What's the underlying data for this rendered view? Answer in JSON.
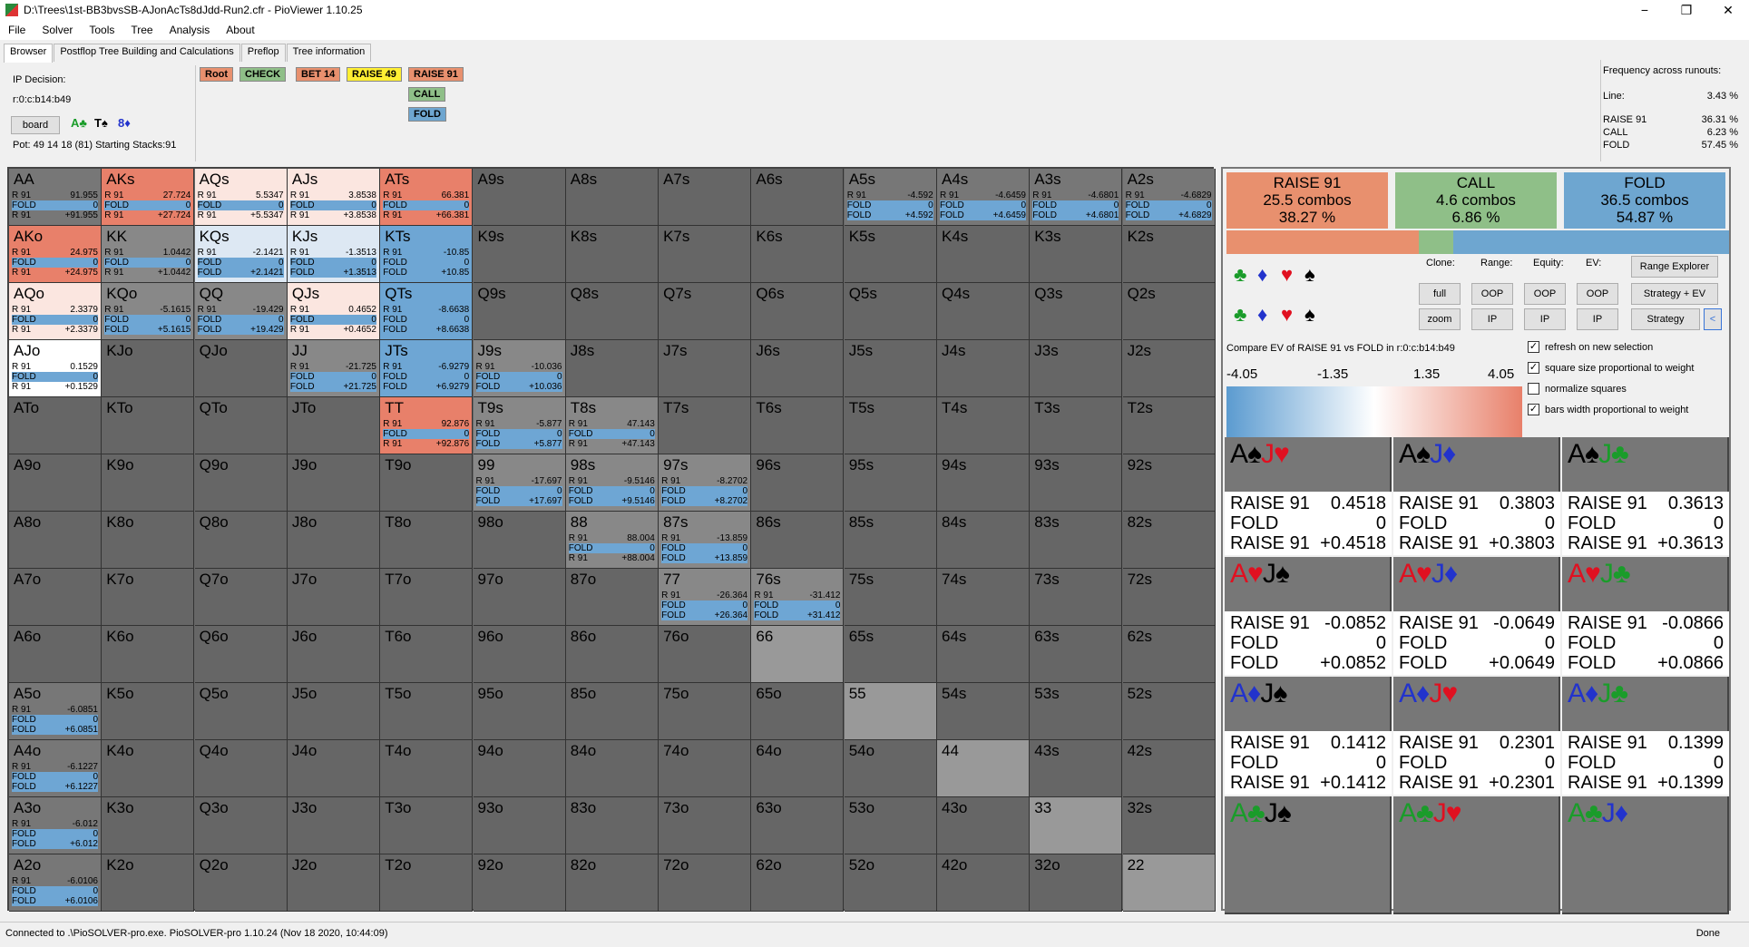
{
  "window": {
    "title": "D:\\Trees\\1st-BB3bvsSB-AJonAcTs8dJdd-Run2.cfr - PioViewer 1.10.25",
    "minimize": "−",
    "maximize": "❐",
    "close": "✕"
  },
  "menu": [
    "File",
    "Solver",
    "Tools",
    "Tree",
    "Analysis",
    "About"
  ],
  "tabs": [
    "Browser",
    "Postflop Tree Building and Calculations",
    "Preflop",
    "Tree information"
  ],
  "left_info": {
    "decision": "IP Decision:",
    "path": "r:0:c:b14:b49",
    "board_button": "board",
    "board_cards": [
      "A♣",
      "T♠",
      "8♦"
    ],
    "pot": "Pot: 49 14 18 (81) Starting Stacks:91"
  },
  "nodes": [
    "Root",
    "CHECK",
    "BET 14",
    "RAISE 49",
    "RAISE 91",
    "CALL",
    "FOLD"
  ],
  "right_info": {
    "header": "Frequency across runouts:",
    "line_label": "Line:",
    "line_value": "3.43 %",
    "rows": [
      [
        "RAISE 91",
        "36.31 %"
      ],
      [
        "CALL",
        "6.23 %"
      ],
      [
        "FOLD",
        "57.45 %"
      ]
    ]
  },
  "grid": [
    [
      "AA",
      "AKs",
      "AQs",
      "AJs",
      "ATs",
      "A9s",
      "A8s",
      "A7s",
      "A6s",
      "A5s",
      "A4s",
      "A3s",
      "A2s"
    ],
    [
      "AKo",
      "KK",
      "KQs",
      "KJs",
      "KTs",
      "K9s",
      "K8s",
      "K7s",
      "K6s",
      "K5s",
      "K4s",
      "K3s",
      "K2s"
    ],
    [
      "AQo",
      "KQo",
      "QQ",
      "QJs",
      "QTs",
      "Q9s",
      "Q8s",
      "Q7s",
      "Q6s",
      "Q5s",
      "Q4s",
      "Q3s",
      "Q2s"
    ],
    [
      "AJo",
      "KJo",
      "QJo",
      "JJ",
      "JTs",
      "J9s",
      "J8s",
      "J7s",
      "J6s",
      "J5s",
      "J4s",
      "J3s",
      "J2s"
    ],
    [
      "ATo",
      "KTo",
      "QTo",
      "JTo",
      "TT",
      "T9s",
      "T8s",
      "T7s",
      "T6s",
      "T5s",
      "T4s",
      "T3s",
      "T2s"
    ],
    [
      "A9o",
      "K9o",
      "Q9o",
      "J9o",
      "T9o",
      "99",
      "98s",
      "97s",
      "96s",
      "95s",
      "94s",
      "93s",
      "92s"
    ],
    [
      "A8o",
      "K8o",
      "Q8o",
      "J8o",
      "T8o",
      "98o",
      "88",
      "87s",
      "86s",
      "85s",
      "84s",
      "83s",
      "82s"
    ],
    [
      "A7o",
      "K7o",
      "Q7o",
      "J7o",
      "T7o",
      "97o",
      "87o",
      "77",
      "76s",
      "75s",
      "74s",
      "73s",
      "72s"
    ],
    [
      "A6o",
      "K6o",
      "Q6o",
      "J6o",
      "T6o",
      "96o",
      "86o",
      "76o",
      "66",
      "65s",
      "64s",
      "63s",
      "62s"
    ],
    [
      "A5o",
      "K5o",
      "Q5o",
      "J5o",
      "T5o",
      "95o",
      "85o",
      "75o",
      "65o",
      "55",
      "54s",
      "53s",
      "52s"
    ],
    [
      "A4o",
      "K4o",
      "Q4o",
      "J4o",
      "T4o",
      "94o",
      "84o",
      "74o",
      "64o",
      "54o",
      "44",
      "43s",
      "42s"
    ],
    [
      "A3o",
      "K3o",
      "Q3o",
      "J3o",
      "T3o",
      "93o",
      "83o",
      "73o",
      "63o",
      "53o",
      "43o",
      "33",
      "32s"
    ],
    [
      "A2o",
      "K2o",
      "Q2o",
      "J2o",
      "T2o",
      "92o",
      "82o",
      "72o",
      "62o",
      "52o",
      "42o",
      "32o",
      "22"
    ]
  ],
  "cell_data": {
    "AA": {
      "v": [
        "R 91",
        "91.955",
        "FOLD",
        "0",
        "R 91",
        "+91.955"
      ],
      "c": "#777"
    },
    "AKs": {
      "v": [
        "R 91",
        "27.724",
        "FOLD",
        "0",
        "R 91",
        "+27.724"
      ],
      "c": "#e8806a"
    },
    "AQs": {
      "v": [
        "R 91",
        "5.5347",
        "FOLD",
        "0",
        "R 91",
        "+5.5347"
      ],
      "c": "#fbe6e0"
    },
    "AJs": {
      "v": [
        "R 91",
        "3.8538",
        "FOLD",
        "0",
        "R 91",
        "+3.8538"
      ],
      "c": "#fbe6e0"
    },
    "ATs": {
      "v": [
        "R 91",
        "66.381",
        "FOLD",
        "0",
        "R 91",
        "+66.381"
      ],
      "c": "#e8806a"
    },
    "A5s": {
      "v": [
        "R 91",
        "-4.592",
        "FOLD",
        "0",
        "FOLD",
        "+4.592"
      ],
      "c": "#777"
    },
    "A4s": {
      "v": [
        "R 91",
        "-4.6459",
        "FOLD",
        "0",
        "FOLD",
        "+4.6459"
      ],
      "c": "#777"
    },
    "A3s": {
      "v": [
        "R 91",
        "-4.6801",
        "FOLD",
        "0",
        "FOLD",
        "+4.6801"
      ],
      "c": "#777"
    },
    "A2s": {
      "v": [
        "R 91",
        "-4.6829",
        "FOLD",
        "0",
        "FOLD",
        "+4.6829"
      ],
      "c": "#777"
    },
    "AKo": {
      "v": [
        "R 91",
        "24.975",
        "FOLD",
        "0",
        "R 91",
        "+24.975"
      ],
      "c": "#e8806a"
    },
    "KK": {
      "v": [
        "R 91",
        "1.0442",
        "FOLD",
        "0",
        "R 91",
        "+1.0442"
      ],
      "c": "#888"
    },
    "KQs": {
      "v": [
        "R 91",
        "-2.1421",
        "FOLD",
        "0",
        "FOLD",
        "+2.1421"
      ],
      "c": "#dde8f3"
    },
    "KJs": {
      "v": [
        "R 91",
        "-1.3513",
        "FOLD",
        "0",
        "FOLD",
        "+1.3513"
      ],
      "c": "#dde8f3"
    },
    "KTs": {
      "v": [
        "R 91",
        "-10.85",
        "FOLD",
        "0",
        "FOLD",
        "+10.85"
      ],
      "c": "#6ea6d4"
    },
    "AQo": {
      "v": [
        "R 91",
        "2.3379",
        "FOLD",
        "0",
        "R 91",
        "+2.3379"
      ],
      "c": "#fbe6e0"
    },
    "KQo": {
      "v": [
        "R 91",
        "-5.1615",
        "FOLD",
        "0",
        "FOLD",
        "+5.1615"
      ],
      "c": "#888"
    },
    "QQ": {
      "v": [
        "R 91",
        "-19.429",
        "FOLD",
        "0",
        "FOLD",
        "+19.429"
      ],
      "c": "#888"
    },
    "QJs": {
      "v": [
        "R 91",
        "0.4652",
        "FOLD",
        "0",
        "R 91",
        "+0.4652"
      ],
      "c": "#fbe6e0"
    },
    "QTs": {
      "v": [
        "R 91",
        "-8.6638",
        "FOLD",
        "0",
        "FOLD",
        "+8.6638"
      ],
      "c": "#6ea6d4"
    },
    "AJo": {
      "v": [
        "R 91",
        "0.1529",
        "FOLD",
        "0",
        "R 91",
        "+0.1529"
      ],
      "c": "#fff"
    },
    "JJ": {
      "v": [
        "R 91",
        "-21.725",
        "FOLD",
        "0",
        "FOLD",
        "+21.725"
      ],
      "c": "#888"
    },
    "JTs": {
      "v": [
        "R 91",
        "-6.9279",
        "FOLD",
        "0",
        "FOLD",
        "+6.9279"
      ],
      "c": "#6ea6d4"
    },
    "J9s": {
      "v": [
        "R 91",
        "-10.036",
        "FOLD",
        "0",
        "FOLD",
        "+10.036"
      ],
      "c": "#888"
    },
    "TT": {
      "v": [
        "R 91",
        "92.876",
        "FOLD",
        "0",
        "R 91",
        "+92.876"
      ],
      "c": "#e8806a"
    },
    "T9s": {
      "v": [
        "R 91",
        "-5.877",
        "FOLD",
        "0",
        "FOLD",
        "+5.877"
      ],
      "c": "#888"
    },
    "T8s": {
      "v": [
        "R 91",
        "47.143",
        "FOLD",
        "0",
        "R 91",
        "+47.143"
      ],
      "c": "#888"
    },
    "99": {
      "v": [
        "R 91",
        "-17.697",
        "FOLD",
        "0",
        "FOLD",
        "+17.697"
      ],
      "c": "#888"
    },
    "98s": {
      "v": [
        "R 91",
        "-9.5146",
        "FOLD",
        "0",
        "FOLD",
        "+9.5146"
      ],
      "c": "#888"
    },
    "97s": {
      "v": [
        "R 91",
        "-8.2702",
        "FOLD",
        "0",
        "FOLD",
        "+8.2702"
      ],
      "c": "#888"
    },
    "88": {
      "v": [
        "R 91",
        "88.004",
        "FOLD",
        "0",
        "R 91",
        "+88.004"
      ],
      "c": "#888"
    },
    "87s": {
      "v": [
        "R 91",
        "-13.859",
        "FOLD",
        "0",
        "FOLD",
        "+13.859"
      ],
      "c": "#888"
    },
    "77": {
      "v": [
        "R 91",
        "-26.364",
        "FOLD",
        "0",
        "FOLD",
        "+26.364"
      ],
      "c": "#888"
    },
    "76s": {
      "v": [
        "R 91",
        "-31.412",
        "FOLD",
        "0",
        "FOLD",
        "+31.412"
      ],
      "c": "#888"
    },
    "A5o": {
      "v": [
        "R 91",
        "-6.0851",
        "FOLD",
        "0",
        "FOLD",
        "+6.0851"
      ],
      "c": "#777"
    },
    "A4o": {
      "v": [
        "R 91",
        "-6.1227",
        "FOLD",
        "0",
        "FOLD",
        "+6.1227"
      ],
      "c": "#777"
    },
    "A3o": {
      "v": [
        "R 91",
        "-6.012",
        "FOLD",
        "0",
        "FOLD",
        "+6.012"
      ],
      "c": "#777"
    },
    "A2o": {
      "v": [
        "R 91",
        "-6.0106",
        "FOLD",
        "0",
        "FOLD",
        "+6.0106"
      ],
      "c": "#777"
    },
    "66": {
      "v": null,
      "c": "#999"
    },
    "55": {
      "v": null,
      "c": "#999"
    },
    "44": {
      "v": null,
      "c": "#999"
    },
    "33": {
      "v": null,
      "c": "#999"
    },
    "22": {
      "v": null,
      "c": "#999"
    }
  },
  "actions": [
    {
      "label": "RAISE 91",
      "combos": "25.5 combos",
      "pct": "38.27 %",
      "color": "#e8906e"
    },
    {
      "label": "CALL",
      "combos": "4.6 combos",
      "pct": "6.86 %",
      "color": "#8fbf88"
    },
    {
      "label": "FOLD",
      "combos": "36.5 combos",
      "pct": "54.87 %",
      "color": "#6ea6d0"
    }
  ],
  "freq_bar": {
    "raise": 0.3827,
    "call": 0.0686,
    "fold": 0.5487
  },
  "controls": {
    "clone": "Clone:",
    "range": "Range:",
    "equity": "Equity:",
    "ev": "EV:",
    "range_explorer": "Range Explorer",
    "full": "full",
    "zoom": "zoom",
    "oop": "OOP",
    "ip": "IP",
    "strategy_ev": "Strategy + EV",
    "strategy": "Strategy",
    "collapse": "<"
  },
  "compare": "Compare EV of RAISE 91 vs FOLD in r:0:c:b14:b49",
  "gradient_ticks": [
    "-4.05",
    "-1.35",
    "1.35",
    "4.05"
  ],
  "checkboxes": [
    {
      "label": "refresh on new selection",
      "checked": true
    },
    {
      "label": "square size proportional to weight",
      "checked": true
    },
    {
      "label": "normalize squares",
      "checked": false
    },
    {
      "label": "bars width proportional to weight",
      "checked": true
    }
  ],
  "combos": [
    {
      "c1": "A",
      "s1": "♠",
      "c2": "J",
      "s2": "♥",
      "rows": [
        [
          "RAISE 91",
          "0.4518"
        ],
        [
          "FOLD",
          "0"
        ],
        [
          "RAISE 91",
          "+0.4518"
        ]
      ]
    },
    {
      "c1": "A",
      "s1": "♠",
      "c2": "J",
      "s2": "♦",
      "rows": [
        [
          "RAISE 91",
          "0.3803"
        ],
        [
          "FOLD",
          "0"
        ],
        [
          "RAISE 91",
          "+0.3803"
        ]
      ]
    },
    {
      "c1": "A",
      "s1": "♠",
      "c2": "J",
      "s2": "♣",
      "rows": [
        [
          "RAISE 91",
          "0.3613"
        ],
        [
          "FOLD",
          "0"
        ],
        [
          "RAISE 91",
          "+0.3613"
        ]
      ]
    },
    {
      "c1": "A",
      "s1": "♥",
      "c2": "J",
      "s2": "♠",
      "rows": [
        [
          "RAISE 91",
          "-0.0852"
        ],
        [
          "FOLD",
          "0"
        ],
        [
          "FOLD",
          "+0.0852"
        ]
      ]
    },
    {
      "c1": "A",
      "s1": "♥",
      "c2": "J",
      "s2": "♦",
      "rows": [
        [
          "RAISE 91",
          "-0.0649"
        ],
        [
          "FOLD",
          "0"
        ],
        [
          "FOLD",
          "+0.0649"
        ]
      ]
    },
    {
      "c1": "A",
      "s1": "♥",
      "c2": "J",
      "s2": "♣",
      "rows": [
        [
          "RAISE 91",
          "-0.0866"
        ],
        [
          "FOLD",
          "0"
        ],
        [
          "FOLD",
          "+0.0866"
        ]
      ]
    },
    {
      "c1": "A",
      "s1": "♦",
      "c2": "J",
      "s2": "♠",
      "rows": [
        [
          "RAISE 91",
          "0.1412"
        ],
        [
          "FOLD",
          "0"
        ],
        [
          "RAISE 91",
          "+0.1412"
        ]
      ]
    },
    {
      "c1": "A",
      "s1": "♦",
      "c2": "J",
      "s2": "♥",
      "rows": [
        [
          "RAISE 91",
          "0.2301"
        ],
        [
          "FOLD",
          "0"
        ],
        [
          "RAISE 91",
          "+0.2301"
        ]
      ]
    },
    {
      "c1": "A",
      "s1": "♦",
      "c2": "J",
      "s2": "♣",
      "rows": [
        [
          "RAISE 91",
          "0.1399"
        ],
        [
          "FOLD",
          "0"
        ],
        [
          "RAISE 91",
          "+0.1399"
        ]
      ]
    },
    {
      "c1": "A",
      "s1": "♣",
      "c2": "J",
      "s2": "♠",
      "rows": null
    },
    {
      "c1": "A",
      "s1": "♣",
      "c2": "J",
      "s2": "♥",
      "rows": null
    },
    {
      "c1": "A",
      "s1": "♣",
      "c2": "J",
      "s2": "♦",
      "rows": null
    }
  ],
  "status": {
    "left": "Connected to .\\PioSOLVER-pro.exe. PioSOLVER-pro 1.10.24 (Nov 18 2020, 10:44:09)",
    "right": "Done"
  }
}
